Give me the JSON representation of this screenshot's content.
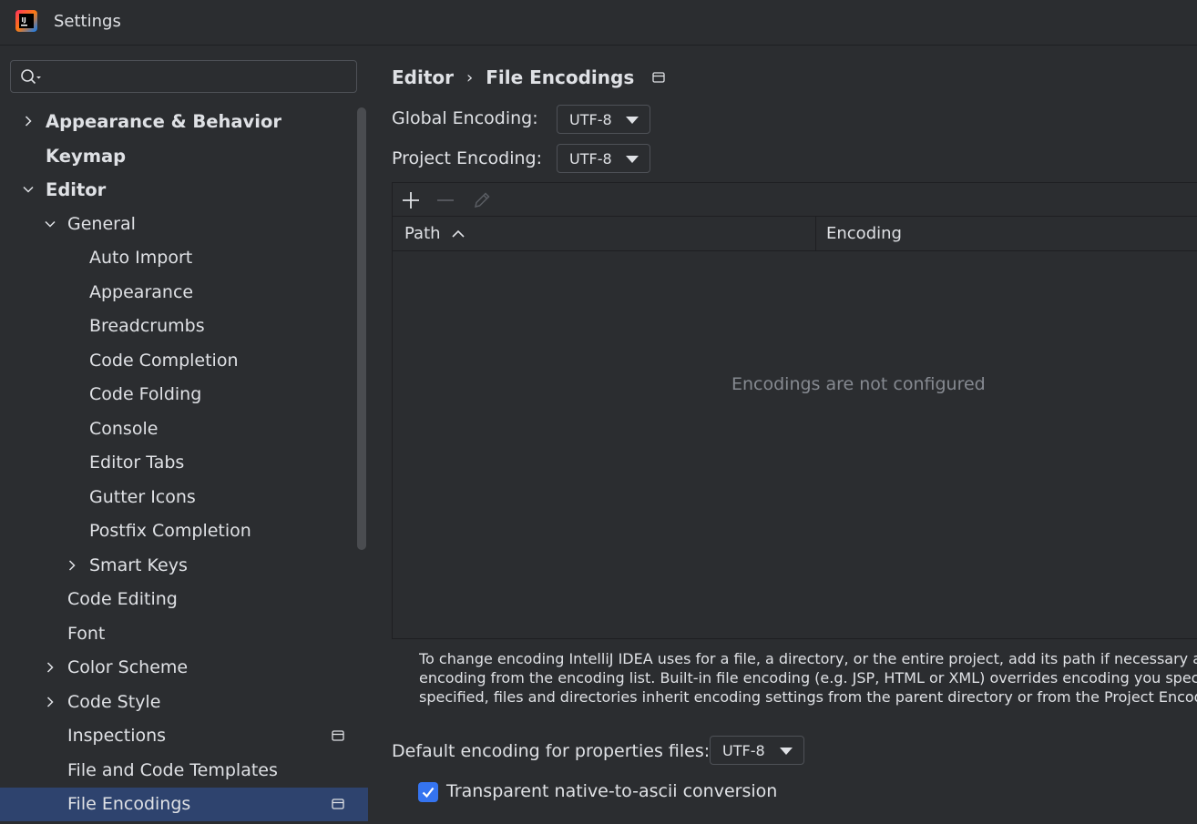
{
  "window": {
    "title": "Settings"
  },
  "sidebar": {
    "search": {
      "value": "",
      "placeholder": ""
    },
    "items": [
      {
        "label": "Appearance & Behavior",
        "level": 0,
        "bold": true,
        "chevron": "right"
      },
      {
        "label": "Keymap",
        "level": 0,
        "bold": true,
        "chevron": "none"
      },
      {
        "label": "Editor",
        "level": 0,
        "bold": true,
        "chevron": "down"
      },
      {
        "label": "General",
        "level": 1,
        "bold": false,
        "chevron": "down"
      },
      {
        "label": "Auto Import",
        "level": 2,
        "bold": false,
        "chevron": "none"
      },
      {
        "label": "Appearance",
        "level": 2,
        "bold": false,
        "chevron": "none"
      },
      {
        "label": "Breadcrumbs",
        "level": 2,
        "bold": false,
        "chevron": "none"
      },
      {
        "label": "Code Completion",
        "level": 2,
        "bold": false,
        "chevron": "none"
      },
      {
        "label": "Code Folding",
        "level": 2,
        "bold": false,
        "chevron": "none"
      },
      {
        "label": "Console",
        "level": 2,
        "bold": false,
        "chevron": "none"
      },
      {
        "label": "Editor Tabs",
        "level": 2,
        "bold": false,
        "chevron": "none"
      },
      {
        "label": "Gutter Icons",
        "level": 2,
        "bold": false,
        "chevron": "none"
      },
      {
        "label": "Postfix Completion",
        "level": 2,
        "bold": false,
        "chevron": "none"
      },
      {
        "label": "Smart Keys",
        "level": 2,
        "bold": false,
        "chevron": "right"
      },
      {
        "label": "Code Editing",
        "level": 1,
        "bold": false,
        "chevron": "none"
      },
      {
        "label": "Font",
        "level": 1,
        "bold": false,
        "chevron": "none"
      },
      {
        "label": "Color Scheme",
        "level": 1,
        "bold": false,
        "chevron": "right"
      },
      {
        "label": "Code Style",
        "level": 1,
        "bold": false,
        "chevron": "right"
      },
      {
        "label": "Inspections",
        "level": 1,
        "bold": false,
        "chevron": "none",
        "badge": "project-scope-icon"
      },
      {
        "label": "File and Code Templates",
        "level": 1,
        "bold": false,
        "chevron": "none"
      },
      {
        "label": "File Encodings",
        "level": 1,
        "bold": false,
        "chevron": "none",
        "badge": "project-scope-icon",
        "selected": true
      }
    ]
  },
  "main": {
    "breadcrumb": {
      "parent": "Editor",
      "separator": "›",
      "current": "File Encodings"
    },
    "global_encoding": {
      "label": "Global Encoding:",
      "value": "UTF-8"
    },
    "project_encoding": {
      "label": "Project Encoding:",
      "value": "UTF-8"
    },
    "table": {
      "toolbar": [
        "add-icon",
        "remove-icon",
        "edit-icon"
      ],
      "columns": {
        "path": "Path",
        "encoding": "Encoding"
      },
      "empty_text": "Encodings are not configured",
      "rows": []
    },
    "help_text": [
      "To change encoding IntelliJ IDEA uses for a file, a directory, or the entire project, add its path if necessary a",
      "encoding from the encoding list. Built-in file encoding (e.g. JSP, HTML or XML) overrides encoding you spec",
      "specified, files and directories inherit encoding settings from the parent directory or from the Project Encodi"
    ],
    "properties_encoding": {
      "label": "Default encoding for properties files:",
      "value": "UTF-8"
    },
    "native_to_ascii": {
      "label": "Transparent native-to-ascii conversion",
      "checked": true
    }
  },
  "colors": {
    "background": "#2b2d30",
    "selection": "#2e436e",
    "accent": "#3574f0",
    "text": "#dfe1e5",
    "muted_text": "#868a91",
    "border": "#4e5157"
  }
}
